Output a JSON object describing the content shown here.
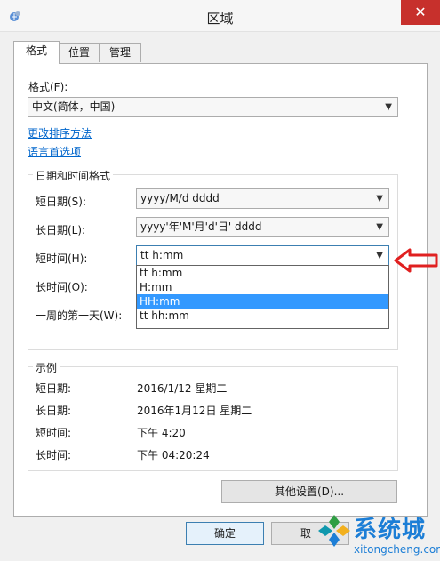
{
  "window": {
    "title": "区域",
    "close_glyph": "✕"
  },
  "tabs": [
    {
      "label": "格式",
      "active": true
    },
    {
      "label": "位置",
      "active": false
    },
    {
      "label": "管理",
      "active": false
    }
  ],
  "format": {
    "label": "格式(F):",
    "value": "中文(简体，中国)",
    "link_sort": "更改排序方法",
    "link_language": "语言首选项"
  },
  "datetime_group": {
    "title": "日期和时间格式",
    "short_date": {
      "label": "短日期(S):",
      "value": "yyyy/M/d dddd"
    },
    "long_date": {
      "label": "长日期(L):",
      "value": "yyyy'年'M'月'd'日' dddd"
    },
    "short_time": {
      "label": "短时间(H):",
      "value": "tt h:mm"
    },
    "long_time": {
      "label": "长时间(O):"
    },
    "first_day": {
      "label": "一周的第一天(W):"
    }
  },
  "dropdown": {
    "options": [
      "tt h:mm",
      "H:mm",
      "HH:mm",
      "tt hh:mm"
    ],
    "selected_index": 2
  },
  "examples": {
    "title": "示例",
    "rows": [
      {
        "label": "短日期:",
        "value": "2016/1/12 星期二"
      },
      {
        "label": "长日期:",
        "value": "2016年1月12日 星期二"
      },
      {
        "label": "短时间:",
        "value": "下午 4:20"
      },
      {
        "label": "长时间:",
        "value": "下午 04:20:24"
      }
    ]
  },
  "buttons": {
    "other_settings": "其他设置(D)...",
    "ok": "确定",
    "cancel": "取"
  },
  "watermark": {
    "brand": "系统城",
    "domain": "xitongcheng.com"
  },
  "colors": {
    "close": "#c7302c",
    "selection": "#3399ff",
    "arrow": "#e02020",
    "link": "#0066cc"
  }
}
